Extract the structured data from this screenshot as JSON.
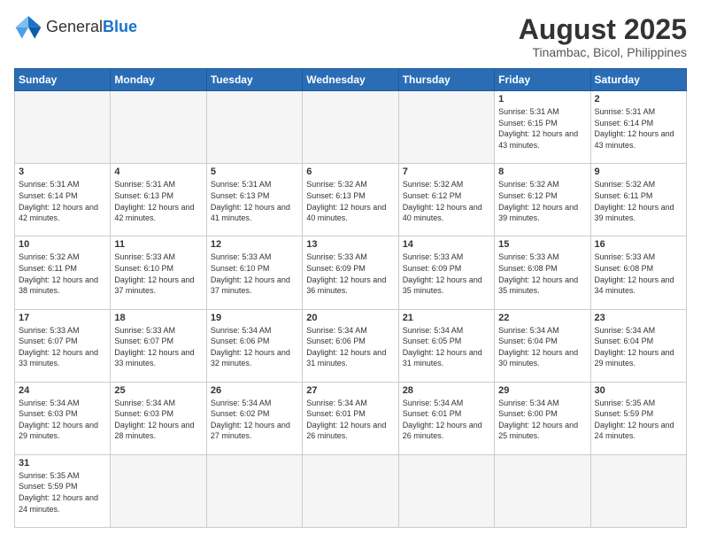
{
  "header": {
    "logo_general": "General",
    "logo_blue": "Blue",
    "month_title": "August 2025",
    "subtitle": "Tinambac, Bicol, Philippines"
  },
  "days_of_week": [
    "Sunday",
    "Monday",
    "Tuesday",
    "Wednesday",
    "Thursday",
    "Friday",
    "Saturday"
  ],
  "weeks": [
    [
      {
        "day": "",
        "empty": true
      },
      {
        "day": "",
        "empty": true
      },
      {
        "day": "",
        "empty": true
      },
      {
        "day": "",
        "empty": true
      },
      {
        "day": "",
        "empty": true
      },
      {
        "day": "1",
        "sunrise": "5:31 AM",
        "sunset": "6:15 PM",
        "daylight": "12 hours and 43 minutes."
      },
      {
        "day": "2",
        "sunrise": "5:31 AM",
        "sunset": "6:14 PM",
        "daylight": "12 hours and 43 minutes."
      }
    ],
    [
      {
        "day": "3",
        "sunrise": "5:31 AM",
        "sunset": "6:14 PM",
        "daylight": "12 hours and 42 minutes."
      },
      {
        "day": "4",
        "sunrise": "5:31 AM",
        "sunset": "6:13 PM",
        "daylight": "12 hours and 42 minutes."
      },
      {
        "day": "5",
        "sunrise": "5:31 AM",
        "sunset": "6:13 PM",
        "daylight": "12 hours and 41 minutes."
      },
      {
        "day": "6",
        "sunrise": "5:32 AM",
        "sunset": "6:13 PM",
        "daylight": "12 hours and 40 minutes."
      },
      {
        "day": "7",
        "sunrise": "5:32 AM",
        "sunset": "6:12 PM",
        "daylight": "12 hours and 40 minutes."
      },
      {
        "day": "8",
        "sunrise": "5:32 AM",
        "sunset": "6:12 PM",
        "daylight": "12 hours and 39 minutes."
      },
      {
        "day": "9",
        "sunrise": "5:32 AM",
        "sunset": "6:11 PM",
        "daylight": "12 hours and 39 minutes."
      }
    ],
    [
      {
        "day": "10",
        "sunrise": "5:32 AM",
        "sunset": "6:11 PM",
        "daylight": "12 hours and 38 minutes."
      },
      {
        "day": "11",
        "sunrise": "5:33 AM",
        "sunset": "6:10 PM",
        "daylight": "12 hours and 37 minutes."
      },
      {
        "day": "12",
        "sunrise": "5:33 AM",
        "sunset": "6:10 PM",
        "daylight": "12 hours and 37 minutes."
      },
      {
        "day": "13",
        "sunrise": "5:33 AM",
        "sunset": "6:09 PM",
        "daylight": "12 hours and 36 minutes."
      },
      {
        "day": "14",
        "sunrise": "5:33 AM",
        "sunset": "6:09 PM",
        "daylight": "12 hours and 35 minutes."
      },
      {
        "day": "15",
        "sunrise": "5:33 AM",
        "sunset": "6:08 PM",
        "daylight": "12 hours and 35 minutes."
      },
      {
        "day": "16",
        "sunrise": "5:33 AM",
        "sunset": "6:08 PM",
        "daylight": "12 hours and 34 minutes."
      }
    ],
    [
      {
        "day": "17",
        "sunrise": "5:33 AM",
        "sunset": "6:07 PM",
        "daylight": "12 hours and 33 minutes."
      },
      {
        "day": "18",
        "sunrise": "5:33 AM",
        "sunset": "6:07 PM",
        "daylight": "12 hours and 33 minutes."
      },
      {
        "day": "19",
        "sunrise": "5:34 AM",
        "sunset": "6:06 PM",
        "daylight": "12 hours and 32 minutes."
      },
      {
        "day": "20",
        "sunrise": "5:34 AM",
        "sunset": "6:06 PM",
        "daylight": "12 hours and 31 minutes."
      },
      {
        "day": "21",
        "sunrise": "5:34 AM",
        "sunset": "6:05 PM",
        "daylight": "12 hours and 31 minutes."
      },
      {
        "day": "22",
        "sunrise": "5:34 AM",
        "sunset": "6:04 PM",
        "daylight": "12 hours and 30 minutes."
      },
      {
        "day": "23",
        "sunrise": "5:34 AM",
        "sunset": "6:04 PM",
        "daylight": "12 hours and 29 minutes."
      }
    ],
    [
      {
        "day": "24",
        "sunrise": "5:34 AM",
        "sunset": "6:03 PM",
        "daylight": "12 hours and 29 minutes."
      },
      {
        "day": "25",
        "sunrise": "5:34 AM",
        "sunset": "6:03 PM",
        "daylight": "12 hours and 28 minutes."
      },
      {
        "day": "26",
        "sunrise": "5:34 AM",
        "sunset": "6:02 PM",
        "daylight": "12 hours and 27 minutes."
      },
      {
        "day": "27",
        "sunrise": "5:34 AM",
        "sunset": "6:01 PM",
        "daylight": "12 hours and 26 minutes."
      },
      {
        "day": "28",
        "sunrise": "5:34 AM",
        "sunset": "6:01 PM",
        "daylight": "12 hours and 26 minutes."
      },
      {
        "day": "29",
        "sunrise": "5:34 AM",
        "sunset": "6:00 PM",
        "daylight": "12 hours and 25 minutes."
      },
      {
        "day": "30",
        "sunrise": "5:35 AM",
        "sunset": "5:59 PM",
        "daylight": "12 hours and 24 minutes."
      }
    ],
    [
      {
        "day": "31",
        "sunrise": "5:35 AM",
        "sunset": "5:59 PM",
        "daylight": "12 hours and 24 minutes.",
        "last": true
      },
      {
        "day": "",
        "empty": true,
        "last": true
      },
      {
        "day": "",
        "empty": true,
        "last": true
      },
      {
        "day": "",
        "empty": true,
        "last": true
      },
      {
        "day": "",
        "empty": true,
        "last": true
      },
      {
        "day": "",
        "empty": true,
        "last": true
      },
      {
        "day": "",
        "empty": true,
        "last": true
      }
    ]
  ]
}
